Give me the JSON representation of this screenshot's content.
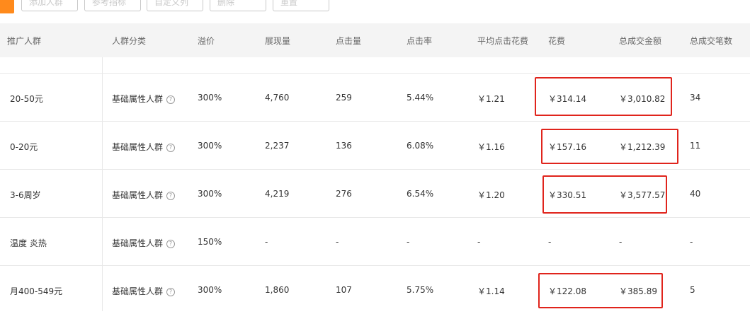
{
  "toolbar": {
    "buttons": [
      "添加人群",
      "参考指标",
      "自定义列",
      "删除",
      "重置"
    ]
  },
  "table": {
    "columns": [
      "推广人群",
      "人群分类",
      "溢价",
      "展现量",
      "点击量",
      "点击率",
      "平均点击花费",
      "花费",
      "总成交金额",
      "总成交笔数"
    ],
    "help_icon_glyph": "?",
    "rows": [
      {
        "name": "20-50元",
        "category": "基础属性人群",
        "premium": "300%",
        "impressions": "4,760",
        "clicks": "259",
        "ctr": "5.44%",
        "cpc": "￥1.21",
        "cost": "￥314.14",
        "gmv": "￥3,010.82",
        "orders": "34"
      },
      {
        "name": "0-20元",
        "category": "基础属性人群",
        "premium": "300%",
        "impressions": "2,237",
        "clicks": "136",
        "ctr": "6.08%",
        "cpc": "￥1.16",
        "cost": "￥157.16",
        "gmv": "￥1,212.39",
        "orders": "11"
      },
      {
        "name": "3-6周岁",
        "category": "基础属性人群",
        "premium": "300%",
        "impressions": "4,219",
        "clicks": "276",
        "ctr": "6.54%",
        "cpc": "￥1.20",
        "cost": "￥330.51",
        "gmv": "￥3,577.57",
        "orders": "40"
      },
      {
        "name": "温度 炎热",
        "category": "基础属性人群",
        "premium": "150%",
        "impressions": "-",
        "clicks": "-",
        "ctr": "-",
        "cpc": "-",
        "cost": "-",
        "gmv": "-",
        "orders": "-"
      },
      {
        "name": "月400-549元",
        "category": "基础属性人群",
        "premium": "300%",
        "impressions": "1,860",
        "clicks": "107",
        "ctr": "5.75%",
        "cpc": "￥1.14",
        "cost": "￥122.08",
        "gmv": "￥385.89",
        "orders": "5"
      }
    ]
  },
  "colors": {
    "accent": "#ff8a1c",
    "highlight_box": "#e0241c",
    "header_bg": "#f4f4f4",
    "border": "#e8e8e8"
  }
}
